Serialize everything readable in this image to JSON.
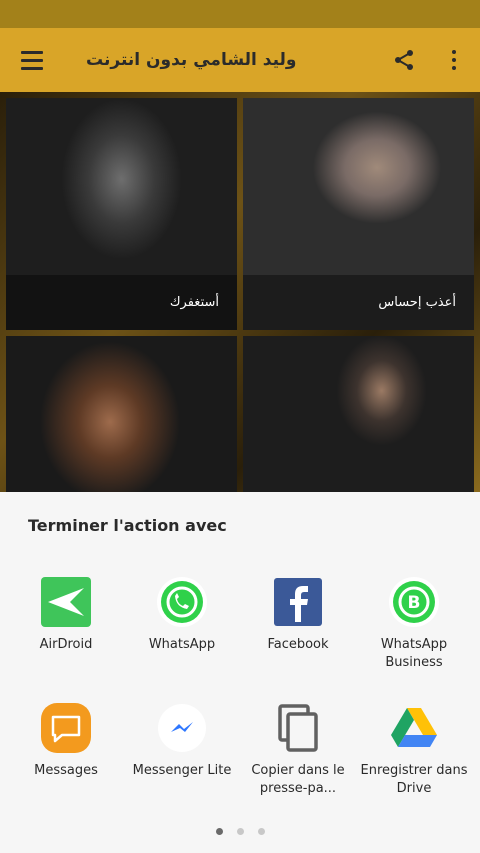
{
  "app_bar": {
    "title": "وليد الشامي بدون انترنت"
  },
  "gallery": {
    "items": [
      {
        "caption": "أستغفرك"
      },
      {
        "caption": "أعذب إحساس"
      },
      {
        "caption": ""
      },
      {
        "caption": ""
      }
    ]
  },
  "share_sheet": {
    "title": "Terminer l'action avec",
    "apps": [
      {
        "label": "AirDroid",
        "icon": "airdroid-icon"
      },
      {
        "label": "WhatsApp",
        "icon": "whatsapp-icon"
      },
      {
        "label": "Facebook",
        "icon": "facebook-icon"
      },
      {
        "label": "WhatsApp Business",
        "icon": "whatsapp-business-icon"
      },
      {
        "label": "Messages",
        "icon": "messages-icon"
      },
      {
        "label": "Messenger Lite",
        "icon": "messenger-lite-icon"
      },
      {
        "label": "Copier dans le presse-pa...",
        "icon": "copy-icon"
      },
      {
        "label": "Enregistrer dans Drive",
        "icon": "drive-icon"
      }
    ],
    "page_count": 3,
    "active_page": 1
  },
  "colors": {
    "status_bar": "#a3811a",
    "app_bar": "#d9a528",
    "sheet_background": "#f6f6f6"
  }
}
